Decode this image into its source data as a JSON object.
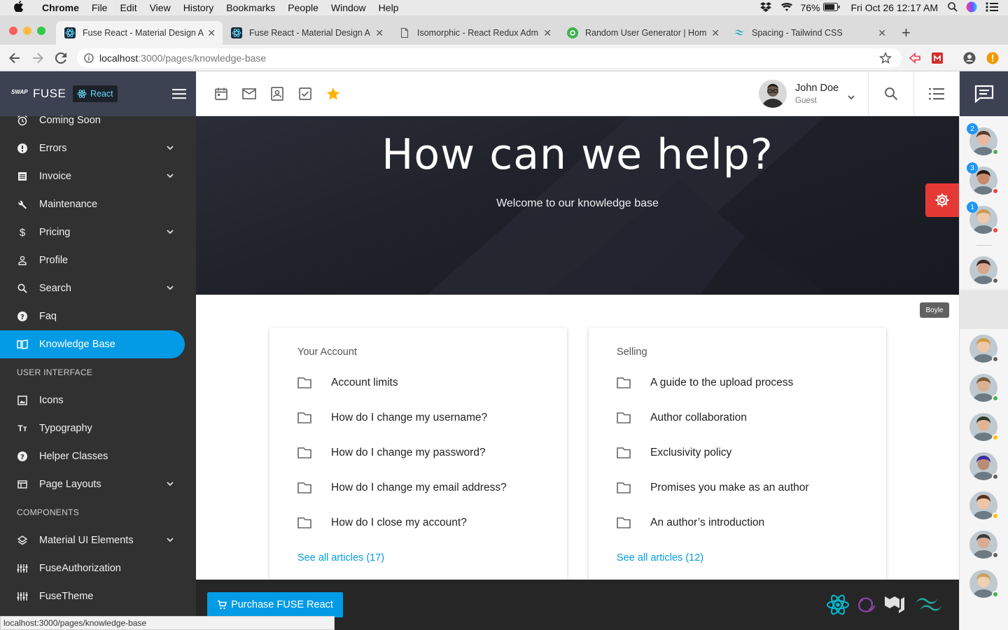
{
  "mac_menubar": {
    "apple": "",
    "items": [
      "Chrome",
      "File",
      "Edit",
      "View",
      "History",
      "Bookmarks",
      "People",
      "Window",
      "Help"
    ],
    "battery": "76%",
    "datetime": "Fri Oct 26  12:17 AM"
  },
  "browser": {
    "tabs": [
      {
        "title": "Fuse React - Material Design A",
        "active": true
      },
      {
        "title": "Fuse React - Material Design A",
        "active": false
      },
      {
        "title": "Isomorphic - React Redux Adm",
        "active": false
      },
      {
        "title": "Random User Generator | Hom",
        "active": false
      },
      {
        "title": "Spacing - Tailwind CSS",
        "active": false
      }
    ],
    "new_tab": "+",
    "url_host": "localhost",
    "url_path": ":3000/pages/knowledge-base",
    "status_url": "localhost:3000/pages/knowledge-base"
  },
  "sidebar": {
    "logo_text": "FUSE",
    "logo_mark": "SWAP",
    "badge": "React",
    "items": [
      {
        "label": "Coming Soon",
        "icon": "alarm-icon",
        "chevron": false
      },
      {
        "label": "Errors",
        "icon": "error-icon",
        "chevron": true
      },
      {
        "label": "Invoice",
        "icon": "receipt-icon",
        "chevron": true
      },
      {
        "label": "Maintenance",
        "icon": "wrench-icon",
        "chevron": false
      },
      {
        "label": "Pricing",
        "icon": "dollar-icon",
        "chevron": true
      },
      {
        "label": "Profile",
        "icon": "person-icon",
        "chevron": false
      },
      {
        "label": "Search",
        "icon": "search-icon",
        "chevron": true
      },
      {
        "label": "Faq",
        "icon": "help-icon",
        "chevron": false
      },
      {
        "label": "Knowledge Base",
        "icon": "book-icon",
        "chevron": false,
        "active": true
      }
    ],
    "section_ui": "USER INTERFACE",
    "ui_items": [
      {
        "label": "Icons",
        "icon": "image-icon",
        "chevron": false
      },
      {
        "label": "Typography",
        "icon": "text-icon",
        "chevron": false
      },
      {
        "label": "Helper Classes",
        "icon": "help-icon",
        "chevron": false
      },
      {
        "label": "Page Layouts",
        "icon": "layout-icon",
        "chevron": true
      }
    ],
    "section_components": "COMPONENTS",
    "comp_items": [
      {
        "label": "Material UI Elements",
        "icon": "layers-icon",
        "chevron": true
      },
      {
        "label": "FuseAuthorization",
        "icon": "sliders-icon",
        "chevron": false
      },
      {
        "label": "FuseTheme",
        "icon": "sliders-icon",
        "chevron": false
      }
    ]
  },
  "toolbar": {
    "shortcuts": [
      "calendar-icon",
      "mail-icon",
      "contacts-icon",
      "todo-icon",
      "star-icon"
    ],
    "user_name": "John Doe",
    "user_role": "Guest"
  },
  "hero": {
    "title": "How can we help?",
    "subtitle": "Welcome to our knowledge base"
  },
  "cards": [
    {
      "title": "Your Account",
      "articles": [
        "Account limits",
        "How do I change my username?",
        "How do I change my password?",
        "How do I change my email address?",
        "How do I close my account?"
      ],
      "see_all": "See all articles (17)"
    },
    {
      "title": "Selling",
      "articles": [
        "A guide to the upload process",
        "Author collaboration",
        "Exclusivity policy",
        "Promises you make as an author",
        "An author’s introduction"
      ],
      "see_all": "See all articles (12)"
    }
  ],
  "footer": {
    "purchase_label": "Purchase FUSE React"
  },
  "chat": {
    "tooltip": "Boyle",
    "contacts": [
      {
        "badge": "2",
        "status": "#4caf50"
      },
      {
        "badge": "3",
        "status": "#f44336"
      },
      {
        "badge": "1",
        "status": "#f44336"
      },
      {
        "badge": "",
        "status": "#616161"
      },
      {
        "badge": "",
        "status": "#616161"
      },
      {
        "badge": "",
        "status": "#616161"
      },
      {
        "badge": "",
        "status": "#4caf50"
      },
      {
        "badge": "",
        "status": "#ffc107"
      },
      {
        "badge": "",
        "status": "#616161"
      },
      {
        "badge": "",
        "status": "#ffc107"
      },
      {
        "badge": "",
        "status": "#616161"
      },
      {
        "badge": "",
        "status": "#4caf50"
      }
    ]
  },
  "colors": {
    "accent": "#039be5",
    "sidebar_bg": "#313131",
    "header_bg": "#3c4252",
    "fab": "#e53935",
    "star": "#ffb300"
  }
}
